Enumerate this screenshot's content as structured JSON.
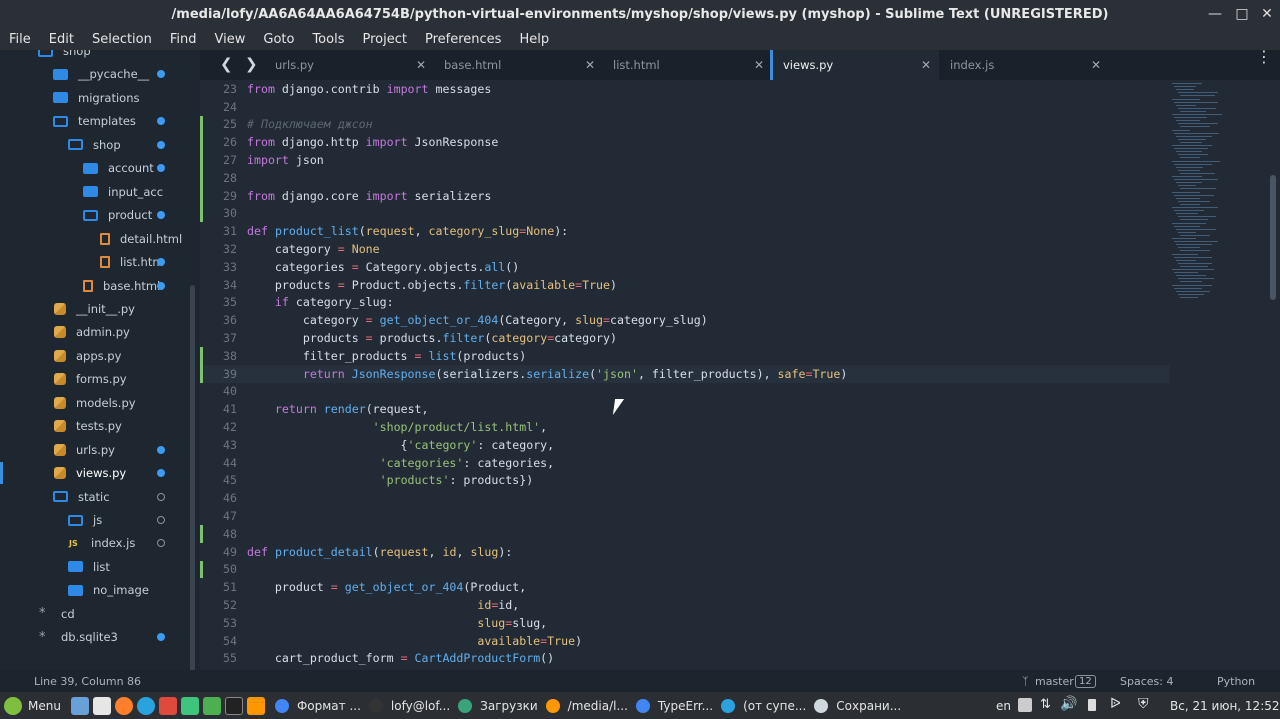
{
  "window": {
    "title": "/media/lofy/AA6A64AA6A64754B/python-virtual-environments/myshop/shop/views.py (myshop) - Sublime Text (UNREGISTERED)"
  },
  "menu": [
    "File",
    "Edit",
    "Selection",
    "Find",
    "View",
    "Goto",
    "Tools",
    "Project",
    "Preferences",
    "Help"
  ],
  "sidebar": {
    "items": [
      {
        "label": "shop",
        "type": "folder-open",
        "depth": 1
      },
      {
        "label": "__pycache__",
        "type": "folder",
        "depth": 2,
        "dot": "filled"
      },
      {
        "label": "migrations",
        "type": "folder",
        "depth": 2
      },
      {
        "label": "templates",
        "type": "folder-open",
        "depth": 2,
        "dot": "filled"
      },
      {
        "label": "shop",
        "type": "folder-open",
        "depth": 3,
        "dot": "filled"
      },
      {
        "label": "account",
        "type": "folder",
        "depth": 4,
        "dot": "filled"
      },
      {
        "label": "input_acc",
        "type": "folder",
        "depth": 4
      },
      {
        "label": "product",
        "type": "folder-open",
        "depth": 4,
        "dot": "filled"
      },
      {
        "label": "detail.html",
        "type": "html",
        "depth": 5
      },
      {
        "label": "list.htm",
        "type": "html",
        "depth": 5,
        "dot": "filled"
      },
      {
        "label": "base.html",
        "type": "html",
        "depth": 4,
        "dot": "filled"
      },
      {
        "label": "__init__.py",
        "type": "py",
        "depth": 3
      },
      {
        "label": "admin.py",
        "type": "py",
        "depth": 3
      },
      {
        "label": "apps.py",
        "type": "py",
        "depth": 3
      },
      {
        "label": "forms.py",
        "type": "py",
        "depth": 3
      },
      {
        "label": "models.py",
        "type": "py",
        "depth": 3
      },
      {
        "label": "tests.py",
        "type": "py",
        "depth": 3
      },
      {
        "label": "urls.py",
        "type": "py",
        "depth": 3,
        "dot": "filled"
      },
      {
        "label": "views.py",
        "type": "py",
        "depth": 3,
        "dot": "filled",
        "selected": true
      },
      {
        "label": "static",
        "type": "folder-open",
        "depth": 2,
        "dot": "hollow"
      },
      {
        "label": "js",
        "type": "folder-open",
        "depth": 3,
        "dot": "hollow"
      },
      {
        "label": "index.js",
        "type": "js",
        "depth": 4,
        "dot": "hollow"
      },
      {
        "label": "list",
        "type": "folder",
        "depth": 3
      },
      {
        "label": "no_image",
        "type": "folder",
        "depth": 3
      },
      {
        "label": "cd",
        "type": "star",
        "depth": 2
      },
      {
        "label": "db.sqlite3",
        "type": "star",
        "depth": 2,
        "dot": "filled"
      }
    ]
  },
  "tabs": [
    {
      "label": "urls.py"
    },
    {
      "label": "base.html"
    },
    {
      "label": "list.html"
    },
    {
      "label": "views.py",
      "active": true
    },
    {
      "label": "index.js"
    }
  ],
  "code": [
    {
      "n": "23",
      "t": [
        [
          "kw",
          "from"
        ],
        [
          "tx",
          " django.contrib "
        ],
        [
          "kw",
          "import"
        ],
        [
          "tx",
          " messages"
        ]
      ]
    },
    {
      "n": "24",
      "t": []
    },
    {
      "n": "25",
      "m": true,
      "t": [
        [
          "cm",
          "# Подключаем джсон"
        ]
      ]
    },
    {
      "n": "26",
      "m": true,
      "t": [
        [
          "kw",
          "from"
        ],
        [
          "tx",
          " django.http "
        ],
        [
          "kw",
          "import"
        ],
        [
          "tx",
          " JsonResponse"
        ]
      ]
    },
    {
      "n": "27",
      "m": true,
      "t": [
        [
          "kw",
          "import"
        ],
        [
          "tx",
          " json"
        ]
      ]
    },
    {
      "n": "28",
      "m": true,
      "t": []
    },
    {
      "n": "29",
      "m": true,
      "t": [
        [
          "kw",
          "from"
        ],
        [
          "tx",
          " django.core "
        ],
        [
          "kw",
          "import"
        ],
        [
          "tx",
          " serializers"
        ]
      ]
    },
    {
      "n": "30",
      "m": true,
      "t": []
    },
    {
      "n": "31",
      "t": [
        [
          "kw",
          "def"
        ],
        [
          "tx",
          " "
        ],
        [
          "fn",
          "product_list"
        ],
        [
          "tx",
          "("
        ],
        [
          "pm",
          "request"
        ],
        [
          "tx",
          ", "
        ],
        [
          "pm",
          "category_slug"
        ],
        [
          "bi",
          "="
        ],
        [
          "cl",
          "None"
        ],
        [
          "tx",
          "):"
        ]
      ]
    },
    {
      "n": "32",
      "t": [
        [
          "tx",
          "    category "
        ],
        [
          "bi",
          "="
        ],
        [
          "tx",
          " "
        ],
        [
          "cl",
          "None"
        ]
      ]
    },
    {
      "n": "33",
      "t": [
        [
          "tx",
          "    categories "
        ],
        [
          "bi",
          "="
        ],
        [
          "tx",
          " Category.objects."
        ],
        [
          "fn",
          "all"
        ],
        [
          "tx",
          "()"
        ]
      ]
    },
    {
      "n": "34",
      "t": [
        [
          "tx",
          "    products "
        ],
        [
          "bi",
          "="
        ],
        [
          "tx",
          " Product.objects."
        ],
        [
          "fn",
          "filter"
        ],
        [
          "tx",
          "("
        ],
        [
          "pm",
          "available"
        ],
        [
          "bi",
          "="
        ],
        [
          "cl",
          "True"
        ],
        [
          "tx",
          ")"
        ]
      ]
    },
    {
      "n": "35",
      "t": [
        [
          "tx",
          "    "
        ],
        [
          "kw",
          "if"
        ],
        [
          "tx",
          " category_slug:"
        ]
      ]
    },
    {
      "n": "36",
      "t": [
        [
          "tx",
          "        category "
        ],
        [
          "bi",
          "="
        ],
        [
          "tx",
          " "
        ],
        [
          "fn",
          "get_object_or_404"
        ],
        [
          "tx",
          "(Category, "
        ],
        [
          "pm",
          "slug"
        ],
        [
          "bi",
          "="
        ],
        [
          "tx",
          "category_slug)"
        ]
      ]
    },
    {
      "n": "37",
      "t": [
        [
          "tx",
          "        products "
        ],
        [
          "bi",
          "="
        ],
        [
          "tx",
          " products."
        ],
        [
          "fn",
          "filter"
        ],
        [
          "tx",
          "("
        ],
        [
          "pm",
          "category"
        ],
        [
          "bi",
          "="
        ],
        [
          "tx",
          "category)"
        ]
      ]
    },
    {
      "n": "38",
      "m": true,
      "t": [
        [
          "tx",
          "        filter_products "
        ],
        [
          "bi",
          "="
        ],
        [
          "tx",
          " "
        ],
        [
          "fn",
          "list"
        ],
        [
          "tx",
          "(products)"
        ]
      ]
    },
    {
      "n": "39",
      "m": true,
      "cur": true,
      "t": [
        [
          "tx",
          "        "
        ],
        [
          "kw",
          "return"
        ],
        [
          "tx",
          " "
        ],
        [
          "fn",
          "JsonResponse"
        ],
        [
          "tx",
          "(serializers."
        ],
        [
          "fn",
          "serialize"
        ],
        [
          "tx",
          "("
        ],
        [
          "str",
          "'json'"
        ],
        [
          "tx",
          ", filter_products), "
        ],
        [
          "pm",
          "safe"
        ],
        [
          "bi",
          "="
        ],
        [
          "cl",
          "True"
        ],
        [
          "tx",
          ")"
        ]
      ]
    },
    {
      "n": "40",
      "t": []
    },
    {
      "n": "41",
      "t": [
        [
          "tx",
          "    "
        ],
        [
          "kw",
          "return"
        ],
        [
          "tx",
          " "
        ],
        [
          "fn",
          "render"
        ],
        [
          "tx",
          "(request,"
        ]
      ]
    },
    {
      "n": "42",
      "t": [
        [
          "tx",
          "                  "
        ],
        [
          "str",
          "'shop/product/list.html'"
        ],
        [
          "tx",
          ","
        ]
      ]
    },
    {
      "n": "43",
      "t": [
        [
          "tx",
          "                      {"
        ],
        [
          "str",
          "'category'"
        ],
        [
          "tx",
          ": category,"
        ]
      ]
    },
    {
      "n": "44",
      "t": [
        [
          "tx",
          "                   "
        ],
        [
          "str",
          "'categories'"
        ],
        [
          "tx",
          ": categories,"
        ]
      ]
    },
    {
      "n": "45",
      "t": [
        [
          "tx",
          "                   "
        ],
        [
          "str",
          "'products'"
        ],
        [
          "tx",
          ": products})"
        ]
      ]
    },
    {
      "n": "46",
      "t": []
    },
    {
      "n": "47",
      "t": []
    },
    {
      "n": "48",
      "m": true,
      "t": []
    },
    {
      "n": "49",
      "t": [
        [
          "kw",
          "def"
        ],
        [
          "tx",
          " "
        ],
        [
          "fn",
          "product_detail"
        ],
        [
          "tx",
          "("
        ],
        [
          "pm",
          "request"
        ],
        [
          "tx",
          ", "
        ],
        [
          "pm",
          "id"
        ],
        [
          "tx",
          ", "
        ],
        [
          "pm",
          "slug"
        ],
        [
          "tx",
          "):"
        ]
      ]
    },
    {
      "n": "50",
      "m": true,
      "t": []
    },
    {
      "n": "51",
      "t": [
        [
          "tx",
          "    product "
        ],
        [
          "bi",
          "="
        ],
        [
          "tx",
          " "
        ],
        [
          "fn",
          "get_object_or_404"
        ],
        [
          "tx",
          "(Product,"
        ]
      ]
    },
    {
      "n": "52",
      "t": [
        [
          "tx",
          "                                 "
        ],
        [
          "pm",
          "id"
        ],
        [
          "bi",
          "="
        ],
        [
          "tx",
          "id,"
        ]
      ]
    },
    {
      "n": "53",
      "t": [
        [
          "tx",
          "                                 "
        ],
        [
          "pm",
          "slug"
        ],
        [
          "bi",
          "="
        ],
        [
          "tx",
          "slug,"
        ]
      ]
    },
    {
      "n": "54",
      "t": [
        [
          "tx",
          "                                 "
        ],
        [
          "pm",
          "available"
        ],
        [
          "bi",
          "="
        ],
        [
          "cl",
          "True"
        ],
        [
          "tx",
          ")"
        ]
      ]
    },
    {
      "n": "55",
      "t": [
        [
          "tx",
          "    cart_product_form "
        ],
        [
          "bi",
          "="
        ],
        [
          "tx",
          " "
        ],
        [
          "fn",
          "CartAddProductForm"
        ],
        [
          "tx",
          "()"
        ]
      ]
    }
  ],
  "status": {
    "position": "Line 39, Column 86",
    "branch": "master",
    "branch_count": "12",
    "spaces": "Spaces: 4",
    "syntax": "Python"
  },
  "taskbar": {
    "menu_label": "Menu",
    "tasks": [
      {
        "label": "Формат ...",
        "color": "#4285f4"
      },
      {
        "label": "lofy@lof...",
        "color": "#333333"
      },
      {
        "label": "Загрузки",
        "color": "#3aa37a"
      },
      {
        "label": "/media/l...",
        "color": "#ff9800"
      },
      {
        "label": "TypeErr...",
        "color": "#4285f4"
      },
      {
        "label": "(от супе...",
        "color": "#2aa2dd"
      },
      {
        "label": "Сохрани...",
        "color": "#cfd8dc"
      }
    ],
    "lang": "en",
    "clock": "Вс, 21 июн, 12:52"
  }
}
